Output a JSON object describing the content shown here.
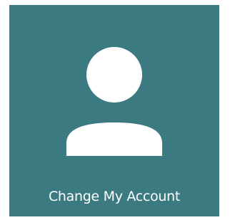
{
  "tile": {
    "label": "Change My Account",
    "icon": "user-avatar-icon",
    "background_color": "#3a7a80",
    "icon_color": "#ffffff"
  }
}
